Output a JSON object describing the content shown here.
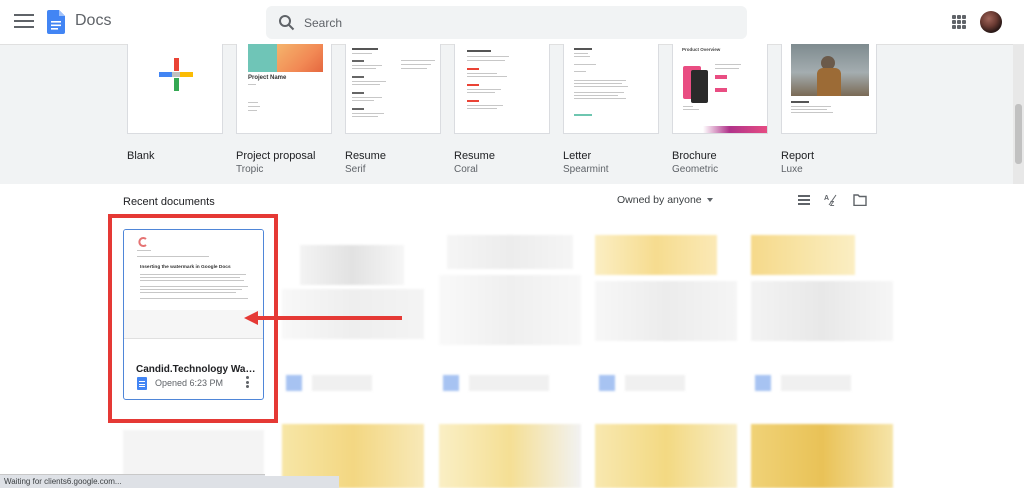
{
  "header": {
    "app_title": "Docs",
    "search_placeholder": "Search",
    "icons": [
      "menu-icon",
      "docs-logo-icon",
      "search-icon",
      "apps-grid-icon",
      "avatar"
    ]
  },
  "templates": [
    {
      "name": "Blank",
      "subtitle": ""
    },
    {
      "name": "Project proposal",
      "subtitle": "Tropic",
      "preview_heading": "Project Name"
    },
    {
      "name": "Resume",
      "subtitle": "Serif"
    },
    {
      "name": "Resume",
      "subtitle": "Coral"
    },
    {
      "name": "Letter",
      "subtitle": "Spearmint"
    },
    {
      "name": "Brochure",
      "subtitle": "Geometric",
      "preview_heading": "Product Overview"
    },
    {
      "name": "Report",
      "subtitle": "Luxe"
    }
  ],
  "recent": {
    "title": "Recent documents",
    "owner_filter": "Owned by anyone",
    "view_icons": [
      "list-view-icon",
      "sort-az-icon",
      "folder-icon"
    ]
  },
  "highlighted_doc": {
    "name": "Candid.Technology Water...",
    "opened": "Opened 6:23 PM",
    "preview_heading": "Inserting the watermark in Google Docs"
  },
  "status_bar": {
    "text": "Waiting for clients6.google.com..."
  },
  "colors": {
    "annotation_red": "#e53935",
    "docs_blue": "#4285f4",
    "card_border": "#4f86d8",
    "band_gray": "#f1f3f4"
  }
}
